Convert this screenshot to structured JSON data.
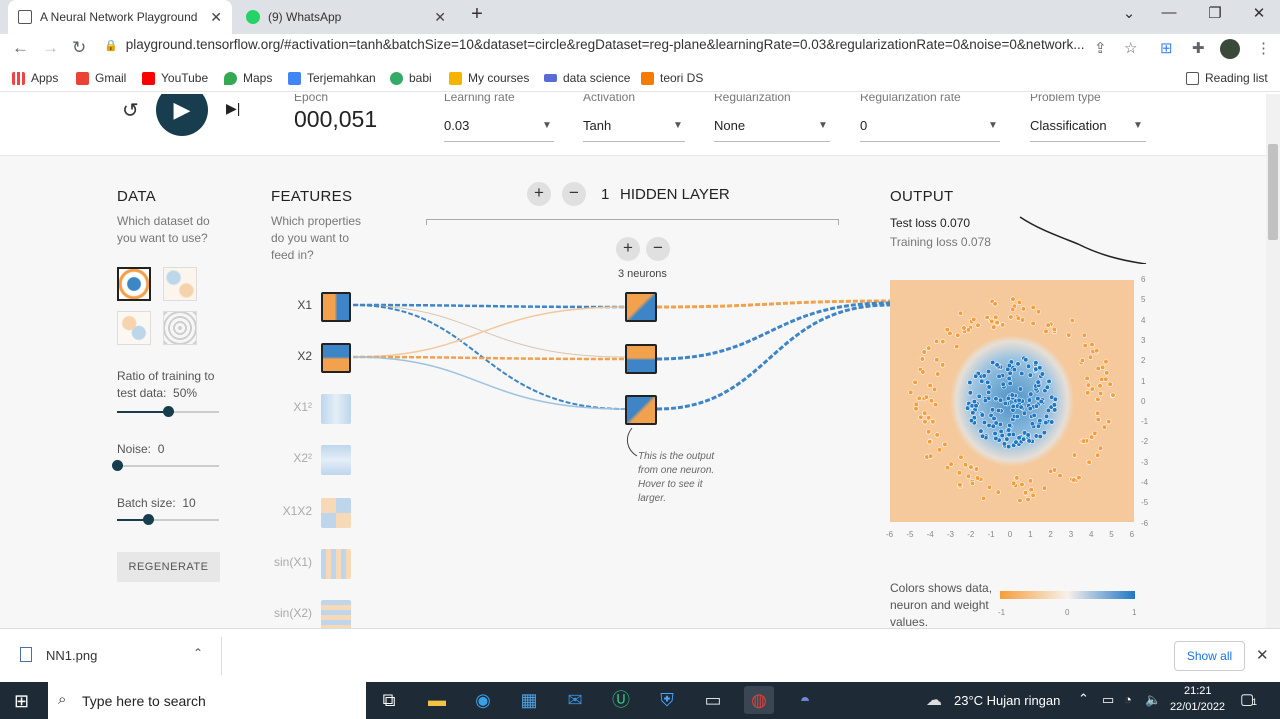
{
  "browser": {
    "tabs": [
      {
        "title": "A Neural Network Playground",
        "active": true
      },
      {
        "title": "(9) WhatsApp",
        "active": false
      }
    ],
    "new_tab": "+",
    "url": "playground.tensorflow.org/#activation=tanh&batchSize=10&dataset=circle&regDataset=reg-plane&learningRate=0.03&regularizationRate=0&noise=0&network...",
    "bookmarks": [
      "Apps",
      "Gmail",
      "YouTube",
      "Maps",
      "Terjemahkan",
      "babi",
      "My courses",
      "data science",
      "teori DS"
    ],
    "reading_list": "Reading list"
  },
  "controls": {
    "epoch_label": "Epoch",
    "epoch_value": "000,051",
    "learning_rate_label": "Learning rate",
    "learning_rate_value": "0.03",
    "activation_label": "Activation",
    "activation_value": "Tanh",
    "regularization_label": "Regularization",
    "regularization_value": "None",
    "reg_rate_label": "Regularization rate",
    "reg_rate_value": "0",
    "problem_label": "Problem type",
    "problem_value": "Classification"
  },
  "data_panel": {
    "title": "DATA",
    "subtitle": "Which dataset do you want to use?",
    "ratio_label": "Ratio of training to test data:",
    "ratio_value": "50%",
    "ratio_level": 0.5,
    "noise_label": "Noise:",
    "noise_value": "0",
    "noise_level": 0,
    "batch_label": "Batch size:",
    "batch_value": "10",
    "batch_level": 0.3,
    "regenerate": "REGENERATE"
  },
  "features": {
    "title": "FEATURES",
    "subtitle": "Which properties do you want to feed in?",
    "items": [
      {
        "label": "X1",
        "active": true
      },
      {
        "label": "X2",
        "active": true
      },
      {
        "label": "X1²",
        "active": false
      },
      {
        "label": "X2²",
        "active": false
      },
      {
        "label": "X1X2",
        "active": false
      },
      {
        "label": "sin(X1)",
        "active": false
      },
      {
        "label": "sin(X2)",
        "active": false
      }
    ]
  },
  "network": {
    "layer_count": "1",
    "layer_label": "HIDDEN LAYER",
    "neurons_label": "3 neurons",
    "tooltip": "This is the output from one neuron. Hover to see it larger."
  },
  "output": {
    "title": "OUTPUT",
    "test_loss": "Test loss 0.070",
    "training_loss": "Training loss 0.078",
    "x_ticks": [
      "-6",
      "-5",
      "-4",
      "-3",
      "-2",
      "-1",
      "0",
      "1",
      "2",
      "3",
      "4",
      "5",
      "6"
    ],
    "y_ticks": [
      "6",
      "5",
      "4",
      "3",
      "2",
      "1",
      "0",
      "-1",
      "-2",
      "-3",
      "-4",
      "-5",
      "-6"
    ],
    "legend_text": "Colors shows data, neuron and weight values.",
    "legend_ticks": [
      "-1",
      "0",
      "1"
    ]
  },
  "download": {
    "file": "NN1.png",
    "show_all": "Show all"
  },
  "taskbar": {
    "search_placeholder": "Type here to search",
    "weather": "23°C  Hujan ringan",
    "time": "21:21",
    "date": "22/01/2022",
    "notif_count": "1"
  }
}
